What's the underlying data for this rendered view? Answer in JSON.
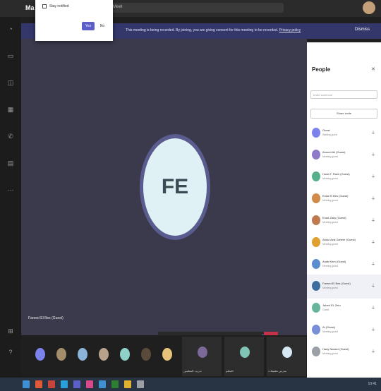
{
  "window": {
    "app_title": "Ma",
    "tab_label": "Meet"
  },
  "popup": {
    "checkbox_label": "Stay notified",
    "confirm_label": "Yes",
    "cancel_label": "No"
  },
  "banner": {
    "text": "This meeting is being recorded. By joining, you are giving consent for this meeting to be recorded.",
    "link": "Privacy policy",
    "dismiss": "Dismiss"
  },
  "stage": {
    "avatar_initials": "FE",
    "presenter_name": "Fareed El Bes (Guest)"
  },
  "controls": {
    "icons": [
      "more-icon",
      "camera-icon",
      "mic-icon",
      "share-icon",
      "ellipsis-icon",
      "hand-icon",
      "chat-icon",
      "people-icon"
    ],
    "leave_glyph": "☎"
  },
  "people_panel": {
    "title": "People",
    "search_placeholder": "Invite someone",
    "share_invite_label": "Share invite",
    "participants": [
      {
        "name": "Guest",
        "status": "Waiting guest",
        "color": "#7b83eb"
      },
      {
        "name": "Ahmed Ali (Guest)",
        "status": "Meeting guest",
        "color": "#8e7ac9"
      },
      {
        "name": "Hoda T. Rami (Guest)",
        "status": "Meeting guest",
        "color": "#56b08a"
      },
      {
        "name": "Enad El Bes (Guest)",
        "status": "Meeting guest",
        "color": "#d28a48"
      },
      {
        "name": "Enad Zaky (Guest)",
        "status": "Meeting guest",
        "color": "#c07a50"
      },
      {
        "name": "Abdul Aziz Zaheer (Guest)",
        "status": "Meeting guest",
        "color": "#e0a030"
      },
      {
        "name": "Anab Kem (Guest)",
        "status": "Meeting guest",
        "color": "#5b8ed1"
      },
      {
        "name": "Fareed El Bes (Guest)",
        "status": "Meeting guest",
        "color": "#3a6f9f"
      },
      {
        "name": "Jahed EL Zein",
        "status": "Guest",
        "color": "#68b59c"
      },
      {
        "name": "Ai (Guest)",
        "status": "Meeting guest",
        "color": "#7a8fd8"
      },
      {
        "name": "Hady Nasser (Guest)",
        "status": "Meeting guest",
        "color": "#9aa0a6"
      }
    ]
  },
  "gallery": {
    "dot_colors": [
      "#7b83eb",
      "#a48d6a",
      "#8ab4d8",
      "#b8a28a",
      "#8fd0c8",
      "#5a4a3a",
      "#e8c47a"
    ],
    "tiles": [
      {
        "name": "تدريب المعلمين",
        "color": "#7b6a9a"
      },
      {
        "name": "المعلم",
        "color": "#7fc4b5"
      },
      {
        "name": "مدرس تطبيقات",
        "color": "#d6e8f4"
      }
    ]
  },
  "taskbar": {
    "icon_colors": [
      "#3f8fd2",
      "#e05a3a",
      "#c6443a",
      "#2ba0d8",
      "#5b5fc7",
      "#d84a8a",
      "#3f8fd2",
      "#2e7d32",
      "#e0b030",
      "#9aa0a6"
    ],
    "time": "10:41"
  },
  "theme": {
    "accent": "#5b5fc7",
    "leave_red": "#c4314b",
    "stage_bg": "#3b3a4d",
    "banner_bg": "#33376a"
  }
}
